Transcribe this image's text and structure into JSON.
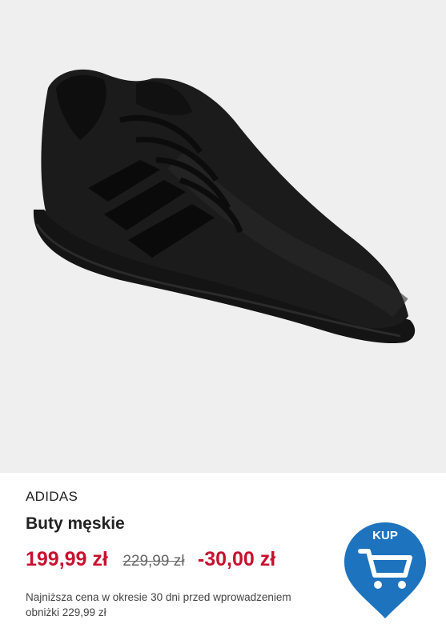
{
  "product": {
    "image": "black-running-shoe",
    "brand": "ADIDAS",
    "name": "Buty męskie",
    "price_current": "199,99 zł",
    "price_old": "229,99 zł",
    "discount": "-30,00 zł",
    "lowest_price_note": "Najniższa cena w okresie 30 dni przed wprowadzeniem obniżki 229,99 zł"
  },
  "buy_button": {
    "label": "KUP",
    "icon": "shopping-cart-icon",
    "color": "#1e73be"
  },
  "colors": {
    "price": "#c8102e",
    "image_background": "#efefef"
  }
}
